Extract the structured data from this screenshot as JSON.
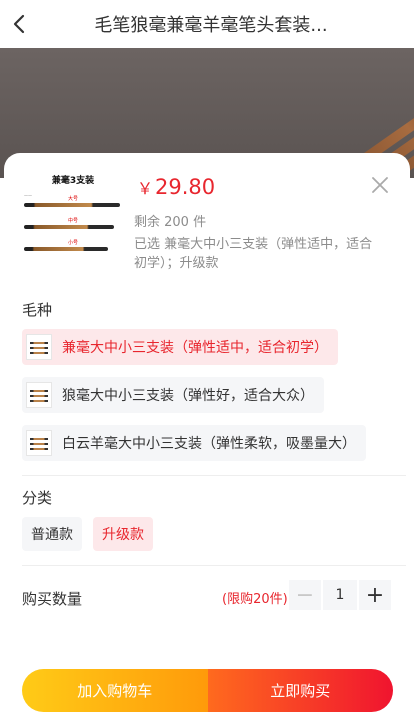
{
  "header": {
    "title": "毛笔狼毫兼毫羊毫笔头套装...",
    "back_icon": "chevron-left-icon"
  },
  "product": {
    "thumb_title": "兼毫3支装",
    "thumb_labels": [
      "大号",
      "中号",
      "小号"
    ],
    "price_symbol": "￥",
    "price": "29.80",
    "stock": "剩余 200 件",
    "selected": "已选 兼毫大中小三支装（弹性适中，适合初学）；升级款",
    "close_icon": "close-icon"
  },
  "spec": {
    "label": "毛种",
    "options": [
      {
        "label": "兼毫大中小三支装（弹性适中，适合初学）",
        "active": true
      },
      {
        "label": "狼毫大中小三支装（弹性好，适合大众）",
        "active": false
      },
      {
        "label": "白云羊毫大中小三支装（弹性柔软，吸墨量大）",
        "active": false
      }
    ]
  },
  "category": {
    "label": "分类",
    "options": [
      {
        "label": "普通款",
        "active": false
      },
      {
        "label": "升级款",
        "active": true
      }
    ]
  },
  "quantity": {
    "label": "购买数量",
    "limit": "(限购20件)",
    "value": "1",
    "minus_label": "−",
    "plus_label": "+"
  },
  "actions": {
    "cart_label": "加入购物车",
    "buy_label": "立即购买"
  },
  "colors": {
    "accent": "#e8262e",
    "cart_gradient": [
      "#ffcb17",
      "#ff9a0a"
    ],
    "buy_gradient": [
      "#ff6a1e",
      "#f0142f"
    ]
  }
}
